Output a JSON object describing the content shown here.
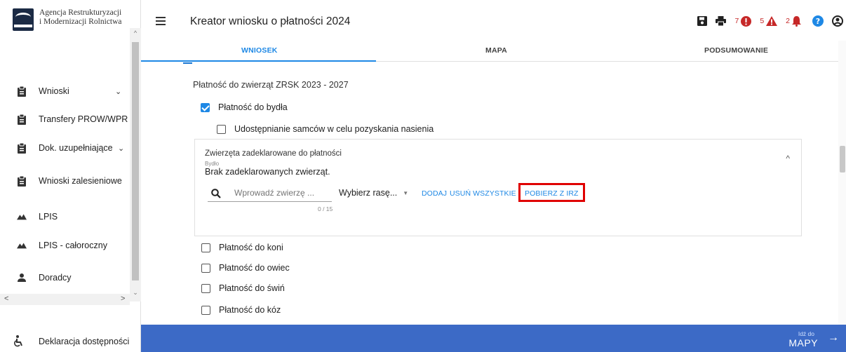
{
  "logo": {
    "line1": "Agencja Restrukturyzacji",
    "line2": "i Modernizacji Rolnictwa"
  },
  "sidebar": {
    "items": [
      {
        "label": "Wnioski",
        "icon": "clipboard-icon",
        "expandable": true
      },
      {
        "label": "Transfery PROW/WPR",
        "icon": "clipboard-icon",
        "expandable": true
      },
      {
        "label": "Dok. uzupełniające",
        "icon": "clipboard-icon",
        "expandable": true
      },
      {
        "label": "Wnioski zalesieniowe",
        "icon": "clipboard-icon",
        "expandable": true
      },
      {
        "label": "LPIS",
        "icon": "mountain-icon",
        "expandable": false
      },
      {
        "label": "LPIS - całoroczny",
        "icon": "mountain-icon",
        "expandable": false
      },
      {
        "label": "Doradcy",
        "icon": "person-icon",
        "expandable": false
      }
    ],
    "accessibility": "Deklaracja dostępności"
  },
  "header": {
    "title": "Kreator wniosku o płatności 2024",
    "errors_count": "7",
    "warnings_count": "5",
    "notifications_count": "2"
  },
  "tabs": [
    "WNIOSEK",
    "MAPA",
    "PODSUMOWANIE"
  ],
  "content": {
    "section_title": "Płatność do zwierząt ZRSK 2023 - 2027",
    "cattle": {
      "label": "Płatność do bydła",
      "checked": true
    },
    "semen": {
      "label": "Udostępnianie samców w celu pozyskania nasienia",
      "checked": false
    },
    "panel": {
      "title": "Zwierzęta zadeklarowane do płatności",
      "subtitle": "Bydło",
      "empty": "Brak zadeklarowanych zwierząt.",
      "search_placeholder": "Wprowadź zwierzę ...",
      "counter": "0 / 15",
      "breed_select": "Wybierz rasę...",
      "add": "DODAJ",
      "remove_all": "USUŃ WSZYSTKIE",
      "fetch_irz": "POBIERZ Z IRZ"
    },
    "others": [
      {
        "label": "Płatność do koni",
        "checked": false
      },
      {
        "label": "Płatność do owiec",
        "checked": false
      },
      {
        "label": "Płatność do świń",
        "checked": false
      },
      {
        "label": "Płatność do kóz",
        "checked": false
      }
    ]
  },
  "footer": {
    "goto_small": "Idź do",
    "goto_big": "MAPY"
  },
  "colors": {
    "accent": "#1e88e5",
    "footer": "#3c6ac6",
    "alert": "#c62828",
    "highlight": "#e00000"
  }
}
